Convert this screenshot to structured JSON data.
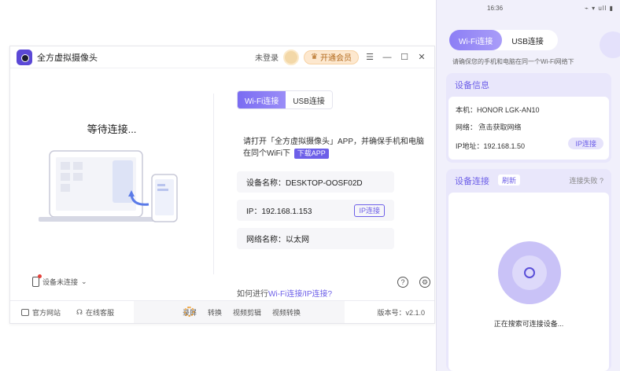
{
  "app": {
    "title": "全方虚拟摄像头",
    "login_text": "未登录",
    "vip_label": "开通会员",
    "controls": [
      "menu-icon",
      "minimize-icon",
      "maximize-icon",
      "close-icon"
    ]
  },
  "left": {
    "waiting_text": "等待连接...",
    "device_status": "设备未连接"
  },
  "right": {
    "tabs": [
      {
        "label": "Wi-Fi连接",
        "active": true
      },
      {
        "label": "USB连接",
        "active": false
      }
    ],
    "instruction": "请打开「全方虚拟摄像头」APP，并确保手机和电脑在同个WiFi下",
    "download_label": "下载APP",
    "device_name": "设备名称：DESKTOP-OOSF02D",
    "ip": "IP：192.168.1.153",
    "ip_button": "IP连接",
    "network_name": "网络名称：以太网",
    "how_prefix": "如何进行",
    "how_link": "Wi-Fi连接/IP连接?"
  },
  "footer": {
    "website": "官方网站",
    "support": "在线客服",
    "mid_items": [
      "录屏",
      "转换",
      "视频剪辑",
      "视频转换"
    ],
    "version": "版本号：v2.1.0"
  },
  "phone": {
    "time": "16:36",
    "sys": "⌁ ▾ ull ▮",
    "tabs": [
      {
        "label": "Wi-Fi连接",
        "active": true
      },
      {
        "label": "USB连接",
        "active": false
      }
    ],
    "hint": "请确保您的手机和电脑在同一个Wi-Fi网络下",
    "device_info_title": "设备信息",
    "model": "本机：HONOR LGK-AN10",
    "network": "网络：  点击获取网络",
    "ip": "IP地址：192.168.1.50",
    "ip_button": "IP连接",
    "device_conn_title": "设备连接",
    "refresh": "刷新",
    "conn_fail": "连接失败 ?",
    "searching": "正在搜索可连接设备..."
  },
  "colors": {
    "accent": "#6d5fe8",
    "vip": "#fde8cf",
    "phone_bg": "#f1f0fb"
  }
}
